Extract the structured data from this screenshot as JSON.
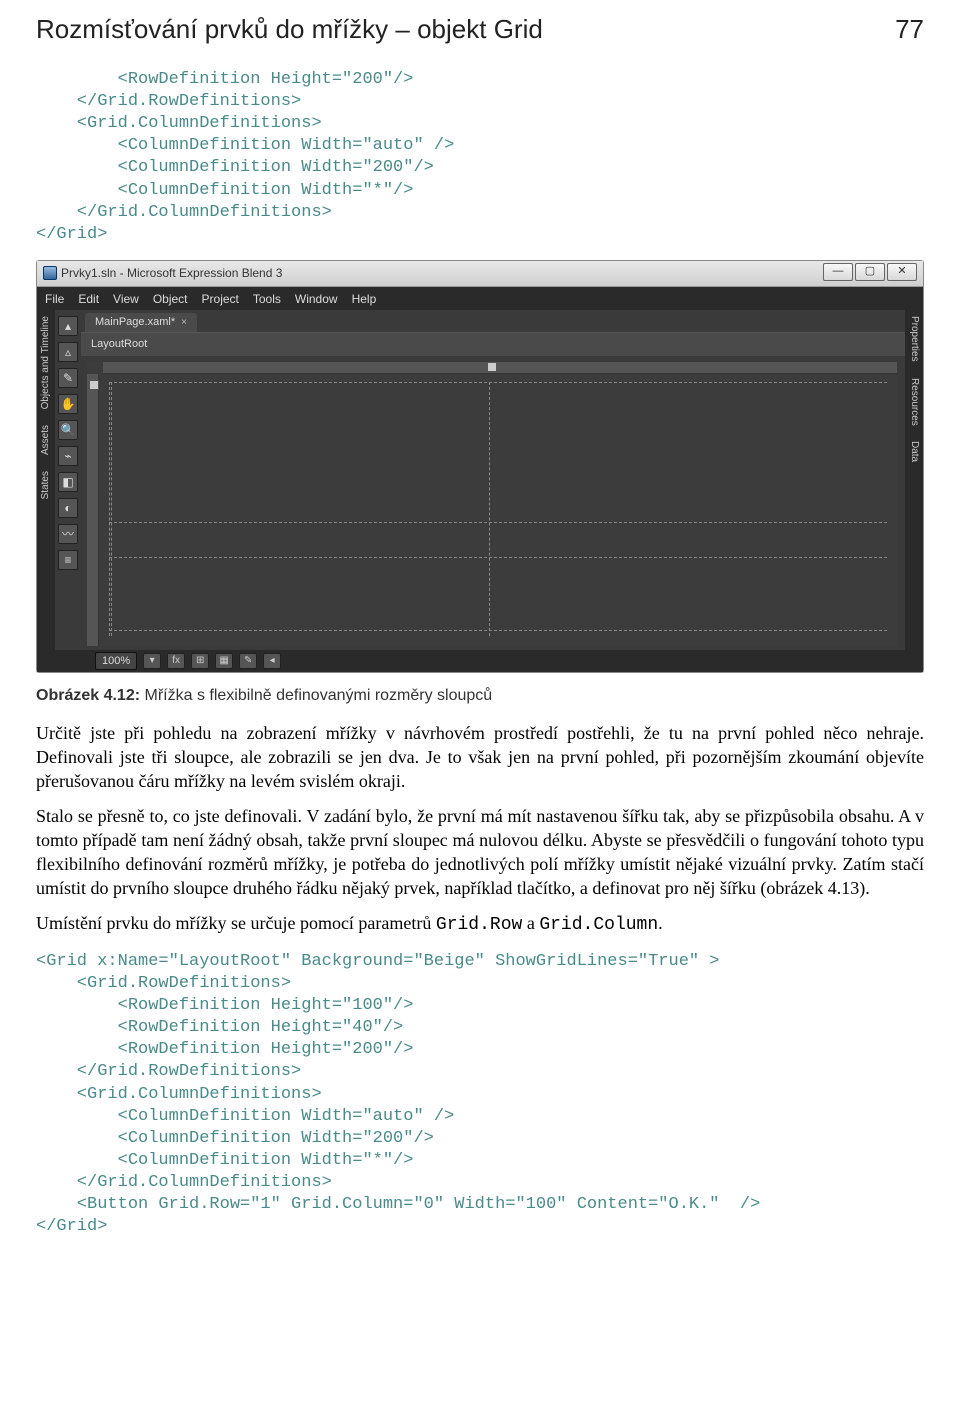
{
  "header": {
    "title": "Rozmísťování prvků do mřížky – objekt Grid",
    "page": "77"
  },
  "code1": "        <RowDefinition Height=\"200\"/>\n    </Grid.RowDefinitions>\n    <Grid.ColumnDefinitions>\n        <ColumnDefinition Width=\"auto\" />\n        <ColumnDefinition Width=\"200\"/>\n        <ColumnDefinition Width=\"*\"/>\n    </Grid.ColumnDefinitions>\n</Grid>",
  "blend": {
    "title": "Prvky1.sln - Microsoft Expression Blend 3",
    "menu": [
      "File",
      "Edit",
      "View",
      "Object",
      "Project",
      "Tools",
      "Window",
      "Help"
    ],
    "left_tabs": [
      "Objects and Timeline",
      "Assets",
      "States"
    ],
    "right_tabs": [
      "Properties",
      "Resources",
      "Data"
    ],
    "doc_tab": "MainPage.xaml*",
    "crumb": "LayoutRoot",
    "zoom": "100%",
    "tool_names": [
      "selection-tool",
      "direct-select-tool",
      "pen-tool",
      "pan-tool",
      "zoom-tool",
      "eyedropper-tool",
      "paint-bucket-tool",
      "gradient-tool",
      "brush-tool",
      "asset-tool"
    ]
  },
  "caption": {
    "prefix": "Obrázek 4.12:",
    "text": " Mřížka s flexibilně definovanými rozměry sloupců"
  },
  "para1": "Určitě jste při pohledu na zobrazení mřížky v návrhovém prostředí postřehli, že tu na první pohled něco nehraje. Definovali jste tři sloupce, ale zobrazili se jen dva. Je to však jen na první pohled, při pozornějším zkoumání objevíte přerušovanou čáru mřížky na levém svislém okraji.",
  "para2": "Stalo se přesně to, co jste definovali. V zadání bylo, že první má mít nastavenou šířku tak, aby se přizpůsobila obsahu. A v tomto případě tam není žádný obsah, takže první sloupec má nulovou délku. Abyste se přesvědčili o fungování tohoto typu flexibilního definování rozměrů mřížky, je potřeba do jednotlivých polí mřížky umístit nějaké vizuální prvky. Zatím stačí umístit do prvního sloupce druhého řádku nějaký prvek, například tlačítko, a definovat pro něj šířku (obrázek 4.13).",
  "para3_before": "Umístění prvku do mřížky se určuje pomocí parametrů ",
  "para3_code1": "Grid.Row",
  "para3_mid": " a ",
  "para3_code2": "Grid.Column",
  "para3_after": ".",
  "code2": "<Grid x:Name=\"LayoutRoot\" Background=\"Beige\" ShowGridLines=\"True\" >\n    <Grid.RowDefinitions>\n        <RowDefinition Height=\"100\"/>\n        <RowDefinition Height=\"40\"/>\n        <RowDefinition Height=\"200\"/>\n    </Grid.RowDefinitions>\n    <Grid.ColumnDefinitions>\n        <ColumnDefinition Width=\"auto\" />\n        <ColumnDefinition Width=\"200\"/>\n        <ColumnDefinition Width=\"*\"/>\n    </Grid.ColumnDefinitions>\n    <Button Grid.Row=\"1\" Grid.Column=\"0\" Width=\"100\" Content=\"O.K.\"  />\n</Grid>"
}
